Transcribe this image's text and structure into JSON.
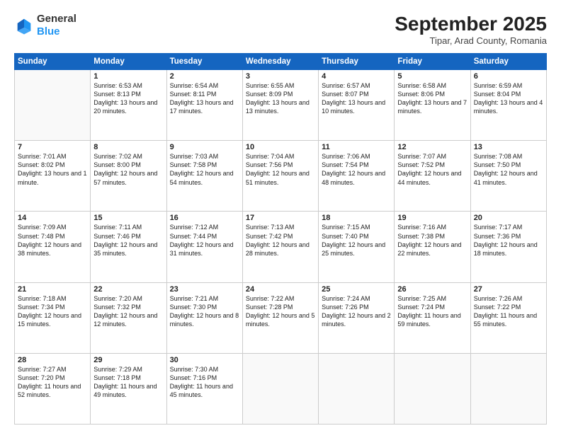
{
  "header": {
    "logo_line1": "General",
    "logo_line2": "Blue",
    "month_year": "September 2025",
    "location": "Tipar, Arad County, Romania"
  },
  "weekdays": [
    "Sunday",
    "Monday",
    "Tuesday",
    "Wednesday",
    "Thursday",
    "Friday",
    "Saturday"
  ],
  "weeks": [
    [
      {
        "day": "",
        "sunrise": "",
        "sunset": "",
        "daylight": ""
      },
      {
        "day": "1",
        "sunrise": "Sunrise: 6:53 AM",
        "sunset": "Sunset: 8:13 PM",
        "daylight": "Daylight: 13 hours and 20 minutes."
      },
      {
        "day": "2",
        "sunrise": "Sunrise: 6:54 AM",
        "sunset": "Sunset: 8:11 PM",
        "daylight": "Daylight: 13 hours and 17 minutes."
      },
      {
        "day": "3",
        "sunrise": "Sunrise: 6:55 AM",
        "sunset": "Sunset: 8:09 PM",
        "daylight": "Daylight: 13 hours and 13 minutes."
      },
      {
        "day": "4",
        "sunrise": "Sunrise: 6:57 AM",
        "sunset": "Sunset: 8:07 PM",
        "daylight": "Daylight: 13 hours and 10 minutes."
      },
      {
        "day": "5",
        "sunrise": "Sunrise: 6:58 AM",
        "sunset": "Sunset: 8:06 PM",
        "daylight": "Daylight: 13 hours and 7 minutes."
      },
      {
        "day": "6",
        "sunrise": "Sunrise: 6:59 AM",
        "sunset": "Sunset: 8:04 PM",
        "daylight": "Daylight: 13 hours and 4 minutes."
      }
    ],
    [
      {
        "day": "7",
        "sunrise": "Sunrise: 7:01 AM",
        "sunset": "Sunset: 8:02 PM",
        "daylight": "Daylight: 13 hours and 1 minute."
      },
      {
        "day": "8",
        "sunrise": "Sunrise: 7:02 AM",
        "sunset": "Sunset: 8:00 PM",
        "daylight": "Daylight: 12 hours and 57 minutes."
      },
      {
        "day": "9",
        "sunrise": "Sunrise: 7:03 AM",
        "sunset": "Sunset: 7:58 PM",
        "daylight": "Daylight: 12 hours and 54 minutes."
      },
      {
        "day": "10",
        "sunrise": "Sunrise: 7:04 AM",
        "sunset": "Sunset: 7:56 PM",
        "daylight": "Daylight: 12 hours and 51 minutes."
      },
      {
        "day": "11",
        "sunrise": "Sunrise: 7:06 AM",
        "sunset": "Sunset: 7:54 PM",
        "daylight": "Daylight: 12 hours and 48 minutes."
      },
      {
        "day": "12",
        "sunrise": "Sunrise: 7:07 AM",
        "sunset": "Sunset: 7:52 PM",
        "daylight": "Daylight: 12 hours and 44 minutes."
      },
      {
        "day": "13",
        "sunrise": "Sunrise: 7:08 AM",
        "sunset": "Sunset: 7:50 PM",
        "daylight": "Daylight: 12 hours and 41 minutes."
      }
    ],
    [
      {
        "day": "14",
        "sunrise": "Sunrise: 7:09 AM",
        "sunset": "Sunset: 7:48 PM",
        "daylight": "Daylight: 12 hours and 38 minutes."
      },
      {
        "day": "15",
        "sunrise": "Sunrise: 7:11 AM",
        "sunset": "Sunset: 7:46 PM",
        "daylight": "Daylight: 12 hours and 35 minutes."
      },
      {
        "day": "16",
        "sunrise": "Sunrise: 7:12 AM",
        "sunset": "Sunset: 7:44 PM",
        "daylight": "Daylight: 12 hours and 31 minutes."
      },
      {
        "day": "17",
        "sunrise": "Sunrise: 7:13 AM",
        "sunset": "Sunset: 7:42 PM",
        "daylight": "Daylight: 12 hours and 28 minutes."
      },
      {
        "day": "18",
        "sunrise": "Sunrise: 7:15 AM",
        "sunset": "Sunset: 7:40 PM",
        "daylight": "Daylight: 12 hours and 25 minutes."
      },
      {
        "day": "19",
        "sunrise": "Sunrise: 7:16 AM",
        "sunset": "Sunset: 7:38 PM",
        "daylight": "Daylight: 12 hours and 22 minutes."
      },
      {
        "day": "20",
        "sunrise": "Sunrise: 7:17 AM",
        "sunset": "Sunset: 7:36 PM",
        "daylight": "Daylight: 12 hours and 18 minutes."
      }
    ],
    [
      {
        "day": "21",
        "sunrise": "Sunrise: 7:18 AM",
        "sunset": "Sunset: 7:34 PM",
        "daylight": "Daylight: 12 hours and 15 minutes."
      },
      {
        "day": "22",
        "sunrise": "Sunrise: 7:20 AM",
        "sunset": "Sunset: 7:32 PM",
        "daylight": "Daylight: 12 hours and 12 minutes."
      },
      {
        "day": "23",
        "sunrise": "Sunrise: 7:21 AM",
        "sunset": "Sunset: 7:30 PM",
        "daylight": "Daylight: 12 hours and 8 minutes."
      },
      {
        "day": "24",
        "sunrise": "Sunrise: 7:22 AM",
        "sunset": "Sunset: 7:28 PM",
        "daylight": "Daylight: 12 hours and 5 minutes."
      },
      {
        "day": "25",
        "sunrise": "Sunrise: 7:24 AM",
        "sunset": "Sunset: 7:26 PM",
        "daylight": "Daylight: 12 hours and 2 minutes."
      },
      {
        "day": "26",
        "sunrise": "Sunrise: 7:25 AM",
        "sunset": "Sunset: 7:24 PM",
        "daylight": "Daylight: 11 hours and 59 minutes."
      },
      {
        "day": "27",
        "sunrise": "Sunrise: 7:26 AM",
        "sunset": "Sunset: 7:22 PM",
        "daylight": "Daylight: 11 hours and 55 minutes."
      }
    ],
    [
      {
        "day": "28",
        "sunrise": "Sunrise: 7:27 AM",
        "sunset": "Sunset: 7:20 PM",
        "daylight": "Daylight: 11 hours and 52 minutes."
      },
      {
        "day": "29",
        "sunrise": "Sunrise: 7:29 AM",
        "sunset": "Sunset: 7:18 PM",
        "daylight": "Daylight: 11 hours and 49 minutes."
      },
      {
        "day": "30",
        "sunrise": "Sunrise: 7:30 AM",
        "sunset": "Sunset: 7:16 PM",
        "daylight": "Daylight: 11 hours and 45 minutes."
      },
      {
        "day": "",
        "sunrise": "",
        "sunset": "",
        "daylight": ""
      },
      {
        "day": "",
        "sunrise": "",
        "sunset": "",
        "daylight": ""
      },
      {
        "day": "",
        "sunrise": "",
        "sunset": "",
        "daylight": ""
      },
      {
        "day": "",
        "sunrise": "",
        "sunset": "",
        "daylight": ""
      }
    ]
  ]
}
